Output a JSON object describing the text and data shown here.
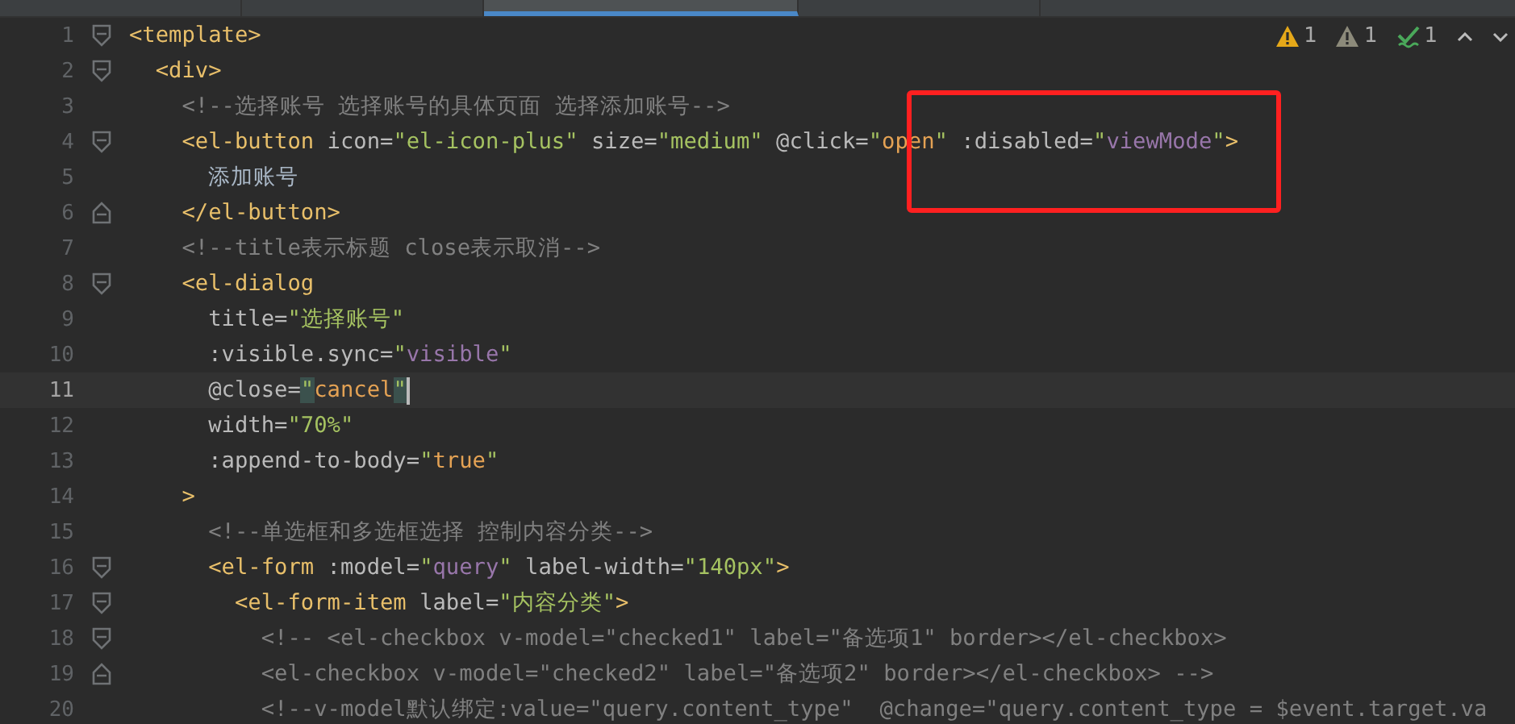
{
  "tabs": [
    {
      "selected": false
    },
    {
      "selected": false
    },
    {
      "selected": true
    },
    {
      "selected": false
    }
  ],
  "inspections": [
    {
      "kind": "warning",
      "count": "1"
    },
    {
      "kind": "weak-warning",
      "count": "1"
    },
    {
      "kind": "typo",
      "count": "1"
    }
  ],
  "lines": [
    {
      "number": "1",
      "fold_start": true,
      "fold_end": false,
      "current": false,
      "tokens": [
        {
          "kind": "tag",
          "text": "<template>"
        }
      ]
    },
    {
      "number": "2",
      "fold_start": true,
      "fold_end": false,
      "current": false,
      "tokens": [
        {
          "kind": "tag",
          "text": "  <div>"
        }
      ]
    },
    {
      "number": "3",
      "fold_start": false,
      "fold_end": false,
      "current": false,
      "tokens": [
        {
          "kind": "comment",
          "text": "    <!--选择账号 选择账号的具体页面 选择添加账号-->"
        }
      ]
    },
    {
      "number": "4",
      "fold_start": true,
      "fold_end": false,
      "current": false,
      "tokens": [
        {
          "kind": "tag",
          "text": "    <el-button "
        },
        {
          "kind": "attr",
          "text": "icon="
        },
        {
          "kind": "str",
          "text": "\"el-icon-plus\""
        },
        {
          "kind": "attr",
          "text": " size="
        },
        {
          "kind": "str",
          "text": "\"medium\""
        },
        {
          "kind": "attr",
          "text": " @click="
        },
        {
          "kind": "str",
          "text": "\""
        },
        {
          "kind": "expr",
          "text": "open"
        },
        {
          "kind": "str",
          "text": "\""
        },
        {
          "kind": "attr",
          "text": " :disabled="
        },
        {
          "kind": "str",
          "text": "\""
        },
        {
          "kind": "var",
          "text": "viewMode"
        },
        {
          "kind": "str",
          "text": "\""
        },
        {
          "kind": "tag",
          "text": ">"
        }
      ]
    },
    {
      "number": "5",
      "fold_start": false,
      "fold_end": false,
      "current": false,
      "tokens": [
        {
          "kind": "text",
          "text": "      添加账号"
        }
      ]
    },
    {
      "number": "6",
      "fold_start": false,
      "fold_end": true,
      "current": false,
      "tokens": [
        {
          "kind": "tag",
          "text": "    </el-button>"
        }
      ]
    },
    {
      "number": "7",
      "fold_start": false,
      "fold_end": false,
      "current": false,
      "tokens": [
        {
          "kind": "comment",
          "text": "    <!--title表示标题 close表示取消-->"
        }
      ]
    },
    {
      "number": "8",
      "fold_start": true,
      "fold_end": false,
      "current": false,
      "tokens": [
        {
          "kind": "tag",
          "text": "    <el-dialog"
        }
      ]
    },
    {
      "number": "9",
      "fold_start": false,
      "fold_end": false,
      "current": false,
      "tokens": [
        {
          "kind": "attr",
          "text": "      title="
        },
        {
          "kind": "str",
          "text": "\"选择账号\""
        }
      ]
    },
    {
      "number": "10",
      "fold_start": false,
      "fold_end": false,
      "current": false,
      "tokens": [
        {
          "kind": "attr",
          "text": "      :visible.sync="
        },
        {
          "kind": "str",
          "text": "\""
        },
        {
          "kind": "var",
          "text": "visible"
        },
        {
          "kind": "str",
          "text": "\""
        }
      ]
    },
    {
      "number": "11",
      "fold_start": false,
      "fold_end": false,
      "current": true,
      "tokens": [
        {
          "kind": "attr",
          "text": "      @close="
        },
        {
          "kind": "match",
          "text": "\""
        },
        {
          "kind": "expr",
          "text": "cancel"
        },
        {
          "kind": "match",
          "text": "\""
        }
      ]
    },
    {
      "number": "12",
      "fold_start": false,
      "fold_end": false,
      "current": false,
      "tokens": [
        {
          "kind": "attr",
          "text": "      width="
        },
        {
          "kind": "str",
          "text": "\"70%\""
        }
      ]
    },
    {
      "number": "13",
      "fold_start": false,
      "fold_end": false,
      "current": false,
      "tokens": [
        {
          "kind": "attr",
          "text": "      :append-to-body="
        },
        {
          "kind": "str",
          "text": "\""
        },
        {
          "kind": "expr",
          "text": "true"
        },
        {
          "kind": "str",
          "text": "\""
        }
      ]
    },
    {
      "number": "14",
      "fold_start": false,
      "fold_end": false,
      "current": false,
      "tokens": [
        {
          "kind": "tag",
          "text": "    >"
        }
      ]
    },
    {
      "number": "15",
      "fold_start": false,
      "fold_end": false,
      "current": false,
      "tokens": [
        {
          "kind": "comment",
          "text": "      <!--单选框和多选框选择 控制内容分类-->"
        }
      ]
    },
    {
      "number": "16",
      "fold_start": true,
      "fold_end": false,
      "current": false,
      "tokens": [
        {
          "kind": "tag",
          "text": "      <el-form "
        },
        {
          "kind": "attr",
          "text": ":model="
        },
        {
          "kind": "str",
          "text": "\""
        },
        {
          "kind": "var",
          "text": "query"
        },
        {
          "kind": "str",
          "text": "\""
        },
        {
          "kind": "attr",
          "text": " label-width="
        },
        {
          "kind": "str",
          "text": "\"140px\""
        },
        {
          "kind": "tag",
          "text": ">"
        }
      ]
    },
    {
      "number": "17",
      "fold_start": true,
      "fold_end": false,
      "current": false,
      "tokens": [
        {
          "kind": "tag",
          "text": "        <el-form-item "
        },
        {
          "kind": "attr",
          "text": "label="
        },
        {
          "kind": "str",
          "text": "\"内容分类\""
        },
        {
          "kind": "tag",
          "text": ">"
        }
      ]
    },
    {
      "number": "18",
      "fold_start": true,
      "fold_end": false,
      "current": false,
      "tokens": [
        {
          "kind": "comment",
          "text": "          <!-- <el-checkbox v-model=\"checked1\" label=\"备选项1\" border></el-checkbox>"
        }
      ]
    },
    {
      "number": "19",
      "fold_start": false,
      "fold_end": true,
      "current": false,
      "tokens": [
        {
          "kind": "comment",
          "text": "          <el-checkbox v-model=\"checked2\" label=\"备选项2\" border></el-checkbox> -->"
        }
      ]
    },
    {
      "number": "20",
      "fold_start": false,
      "fold_end": false,
      "current": false,
      "tokens": [
        {
          "kind": "comment",
          "text": "          <!--v-model默认绑定:value=\"query.content_type\"  @change=\"query.content_type = $event.target.va"
        }
      ]
    }
  ]
}
